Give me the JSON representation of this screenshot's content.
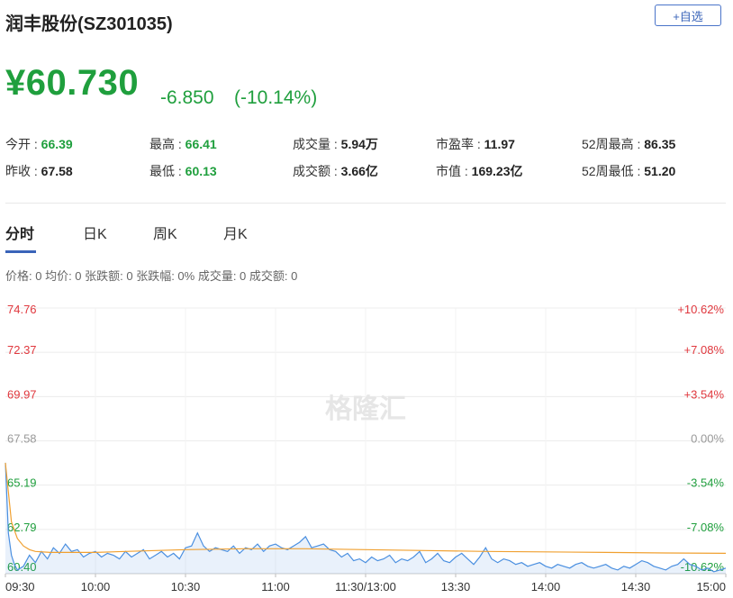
{
  "header": {
    "title": "润丰股份(SZ301035)",
    "add_button": "+自选"
  },
  "quote": {
    "price": "¥60.730",
    "change": "-6.850",
    "change_pct": "(-10.14%)"
  },
  "stats": [
    {
      "label": "今开 : ",
      "value": "66.39",
      "color": "green"
    },
    {
      "label": "最高 : ",
      "value": "66.41",
      "color": "green"
    },
    {
      "label": "成交量 : ",
      "value": "5.94万",
      "color": "dark"
    },
    {
      "label": "市盈率 : ",
      "value": "11.97",
      "color": "dark"
    },
    {
      "label": "52周最高 : ",
      "value": "86.35",
      "color": "dark"
    },
    {
      "label": "昨收 : ",
      "value": "67.58",
      "color": "dark"
    },
    {
      "label": "最低 : ",
      "value": "60.13",
      "color": "green"
    },
    {
      "label": "成交额 : ",
      "value": "3.66亿",
      "color": "dark"
    },
    {
      "label": "市值 : ",
      "value": "169.23亿",
      "color": "dark"
    },
    {
      "label": "52周最低 : ",
      "value": "51.20",
      "color": "dark"
    }
  ],
  "tabs": [
    "分时",
    "日K",
    "周K",
    "月K"
  ],
  "infobar": "价格: 0  均价: 0  张跌额: 0  张跌幅: 0%  成交量: 0  成交额: 0",
  "watermark": "格隆汇",
  "colors": {
    "up": "#e0383e",
    "down": "#1f9f3d",
    "flat": "#999999",
    "price_line": "#4a8fe0",
    "avg_line": "#f0a030"
  },
  "chart_data": {
    "type": "line",
    "x_ticks": [
      "09:30",
      "10:00",
      "10:30",
      "11:00",
      "11:30/13:00",
      "13:30",
      "14:00",
      "14:30",
      "15:00"
    ],
    "y_left": [
      "74.76",
      "72.37",
      "69.97",
      "67.58",
      "65.19",
      "62.79",
      "60.40"
    ],
    "y_right": [
      "+10.62%",
      "+7.08%",
      "+3.54%",
      "0.00%",
      "-3.54%",
      "-7.08%",
      "-10.62%"
    ],
    "ylim": [
      60.4,
      74.76
    ],
    "prev_close": 67.58,
    "series": [
      {
        "color": "#4a8fe0",
        "x": [
          0,
          1,
          2,
          3,
          4,
          6,
          8,
          10,
          12,
          14,
          16,
          18,
          20,
          22,
          24,
          26,
          28,
          30,
          32,
          34,
          36,
          38,
          40,
          42,
          44,
          46,
          48,
          50,
          52,
          54,
          56,
          58,
          60,
          62,
          64,
          66,
          68,
          70,
          72,
          74,
          76,
          78,
          80,
          82,
          84,
          86,
          88,
          90,
          92,
          94,
          96,
          98,
          100,
          102,
          104,
          106,
          108,
          110,
          112,
          114,
          116,
          118,
          120,
          122,
          124,
          126,
          128,
          130,
          132,
          134,
          136,
          138,
          140,
          142,
          144,
          146,
          148,
          150,
          152,
          154,
          156,
          158,
          160,
          162,
          164,
          166,
          168,
          170,
          172,
          174,
          176,
          178,
          180,
          182,
          184,
          186,
          188,
          190,
          192,
          194,
          196,
          198,
          200,
          202,
          204,
          206,
          208,
          210,
          212,
          214,
          216,
          218,
          220,
          222,
          224,
          226,
          228,
          230,
          232,
          234,
          236,
          238,
          240
        ],
        "values": [
          66.39,
          62.6,
          61.4,
          60.9,
          60.6,
          60.8,
          61.4,
          61.0,
          61.6,
          61.2,
          61.8,
          61.5,
          62.0,
          61.6,
          61.7,
          61.3,
          61.5,
          61.6,
          61.3,
          61.5,
          61.4,
          61.2,
          61.6,
          61.3,
          61.5,
          61.7,
          61.2,
          61.4,
          61.6,
          61.3,
          61.5,
          61.2,
          61.8,
          61.9,
          62.6,
          61.9,
          61.6,
          61.8,
          61.7,
          61.6,
          61.9,
          61.5,
          61.8,
          61.7,
          62.0,
          61.6,
          61.9,
          62.0,
          61.8,
          61.7,
          61.9,
          62.1,
          62.4,
          61.8,
          61.9,
          62.0,
          61.7,
          61.6,
          61.3,
          61.5,
          61.1,
          61.2,
          61.0,
          61.3,
          61.1,
          61.2,
          61.4,
          61.0,
          61.2,
          61.1,
          61.3,
          61.6,
          61.0,
          61.2,
          61.5,
          61.1,
          61.0,
          61.3,
          61.5,
          61.2,
          60.9,
          61.3,
          61.8,
          61.2,
          61.0,
          61.2,
          61.1,
          60.9,
          61.0,
          60.8,
          60.9,
          61.0,
          60.8,
          60.7,
          60.9,
          60.8,
          60.7,
          60.9,
          61.0,
          60.8,
          60.7,
          60.8,
          60.9,
          60.7,
          60.6,
          60.8,
          60.7,
          60.9,
          61.1,
          61.0,
          60.8,
          60.7,
          60.6,
          60.8,
          60.9,
          61.2,
          60.9,
          60.8,
          60.6,
          60.7,
          60.5,
          60.6,
          60.7
        ]
      },
      {
        "color": "#f0a030",
        "x": [
          0,
          2,
          4,
          6,
          8,
          10,
          15,
          20,
          30,
          40,
          60,
          80,
          100,
          120,
          140,
          160,
          180,
          200,
          220,
          240
        ],
        "values": [
          66.39,
          63.2,
          62.3,
          61.9,
          61.7,
          61.6,
          61.55,
          61.55,
          61.55,
          61.6,
          61.7,
          61.75,
          61.75,
          61.7,
          61.65,
          61.6,
          61.58,
          61.55,
          61.52,
          61.5
        ]
      }
    ]
  }
}
